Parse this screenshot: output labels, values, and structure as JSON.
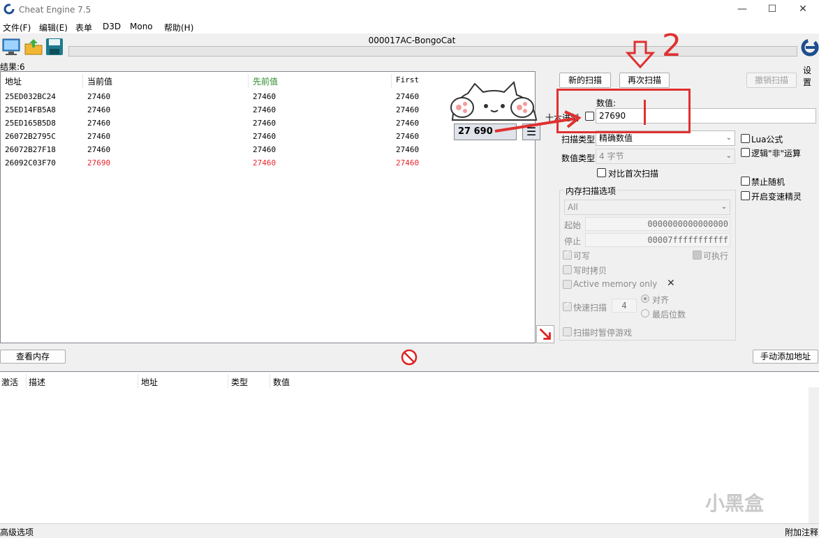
{
  "window": {
    "title": "Cheat Engine 7.5",
    "minimize": "—",
    "maximize": "☐",
    "close": "✕"
  },
  "menu": [
    "文件(F)",
    "编辑(E)",
    "表单",
    "D3D",
    "Mono",
    "帮助(H)"
  ],
  "process_name": "000017AC-BongoCat",
  "settings_label": "设置",
  "results_label": "结果:6",
  "columns": [
    "地址",
    "当前值",
    "先前值",
    "First"
  ],
  "rows": [
    {
      "address": "25ED032BC24",
      "current": "27460",
      "previous": "27460",
      "first": "27460",
      "changed": false
    },
    {
      "address": "25ED14FB5A8",
      "current": "27460",
      "previous": "27460",
      "first": "27460",
      "changed": false
    },
    {
      "address": "25ED165B5D8",
      "current": "27460",
      "previous": "27460",
      "first": "27460",
      "changed": false
    },
    {
      "address": "26072B2795C",
      "current": "27460",
      "previous": "27460",
      "first": "27460",
      "changed": false
    },
    {
      "address": "26072B27F18",
      "current": "27460",
      "previous": "27460",
      "first": "27460",
      "changed": false
    },
    {
      "address": "26092C03F70",
      "current": "27690",
      "previous": "27460",
      "first": "27460",
      "changed": true
    }
  ],
  "buttons": {
    "new_scan": "新的扫描",
    "next_scan": "再次扫描",
    "undo_scan": "撤销扫描",
    "view_memory": "查看内存",
    "add_address": "手动添加地址"
  },
  "value_label": "数值:",
  "hex_label": "十六进制",
  "value_input": "27690",
  "scan_type_label": "扫描类型",
  "scan_type_value": "精确数值",
  "value_type_label": "数值类型",
  "value_type_value": "4 字节",
  "compare_first": "对比首次扫描",
  "right_options": [
    "Lua公式",
    "逻辑\"非\"运算",
    "禁止随机",
    "开启变速精灵"
  ],
  "mem_scan_group": "内存扫描选项",
  "mem_region": "All",
  "start_label": "起始",
  "start_value": "0000000000000000",
  "stop_label": "停止",
  "stop_value": "00007fffffffffff",
  "writable": "可写",
  "executable": "可执行",
  "copy_on_write": "写时拷贝",
  "active_memory": "Active memory only",
  "active_memory_x": "✕",
  "fast_scan": "快速扫描",
  "fast_scan_value": "4",
  "align": "对齐",
  "last_digits": "最后位数",
  "pause_game": "扫描时暂停游戏",
  "lower_columns": [
    "激活",
    "描述",
    "地址",
    "类型",
    "数值"
  ],
  "status_left": "高级选项",
  "status_right": "附加注释",
  "overlay": {
    "counter": "27 690",
    "annotation_number": "2",
    "watermark": "小黑盒"
  },
  "colors": {
    "changed": "#e8262d",
    "previous_header": "#2e8b2e",
    "annotation": "#e03030"
  }
}
